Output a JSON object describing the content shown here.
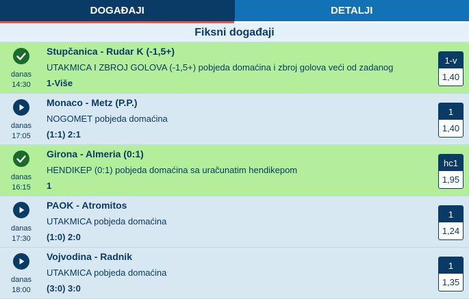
{
  "tabs": {
    "events": "DOGAĐAJI",
    "details": "DETALJI"
  },
  "section_title": "Fiksni događaji",
  "colors": {
    "won_bg": "#b3ef9b",
    "pending_bg": "#d7e8f3",
    "navy": "#0a3a66",
    "tab_blue": "#1372b6"
  },
  "rows": [
    {
      "status": "won",
      "status_icon": "check-icon",
      "day": "danas",
      "time": "14:30",
      "match": "Stupčanica - Rudar K (-1,5+)",
      "desc": "UTAKMICA I ZBROJ GOLOVA (-1,5+) pobjeda domaćina i zbroj golova veći od zadanog",
      "pick": "1-Više",
      "odds_type": "1-v",
      "odds": "1,40"
    },
    {
      "status": "live",
      "status_icon": "play-icon",
      "day": "danas",
      "time": "17:05",
      "match": "Monaco - Metz (P.P.)",
      "desc": "NOGOMET pobjeda domaćina",
      "pick": "(1:1) 2:1",
      "odds_type": "1",
      "odds": "1,40"
    },
    {
      "status": "won",
      "status_icon": "check-icon",
      "day": "danas",
      "time": "16:15",
      "match": "Girona - Almeria (0:1)",
      "desc": "HENDIKEP (0:1) pobjeda domaćina sa uračunatim hendikepom",
      "pick": "1",
      "odds_type": "hc1",
      "odds": "1,95"
    },
    {
      "status": "live",
      "status_icon": "play-icon",
      "day": "danas",
      "time": "17:30",
      "match": "PAOK - Atromitos",
      "desc": "UTAKMICA pobjeda domaćina",
      "pick": "(1:0) 2:0",
      "odds_type": "1",
      "odds": "1,24"
    },
    {
      "status": "live",
      "status_icon": "play-icon",
      "day": "danas",
      "time": "18:00",
      "match": "Vojvodina - Radnik",
      "desc": "UTAKMICA pobjeda domaćina",
      "pick": "(3:0) 3:0",
      "odds_type": "1",
      "odds": "1,35"
    }
  ]
}
